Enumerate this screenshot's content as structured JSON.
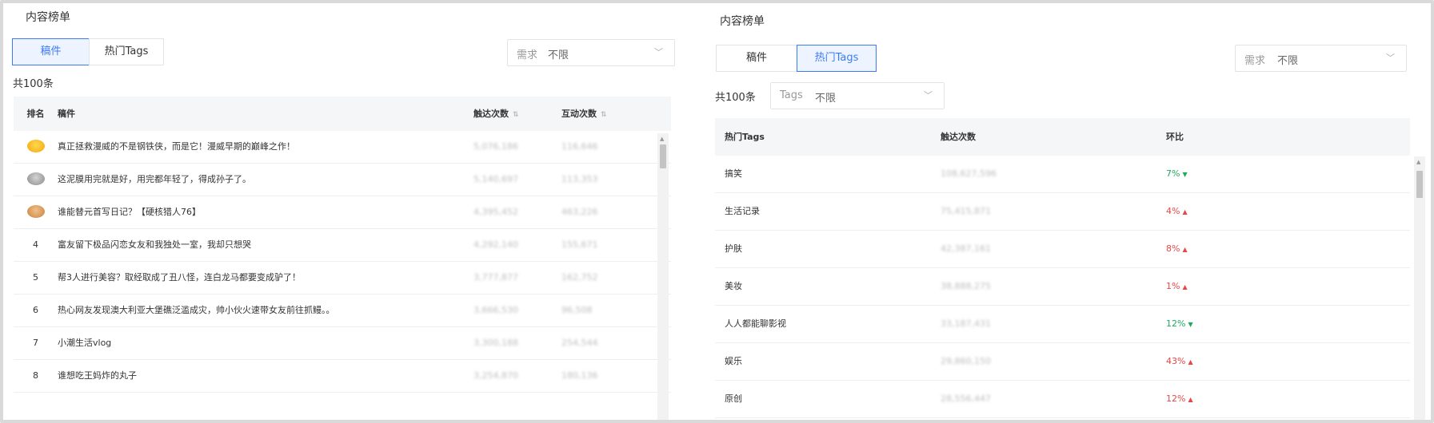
{
  "left": {
    "title": "内容榜单",
    "tabs": [
      {
        "label": "稿件",
        "active": true
      },
      {
        "label": "热门Tags",
        "active": false
      }
    ],
    "need_filter": {
      "label": "需求",
      "value": "不限"
    },
    "count": "共100条",
    "columns": {
      "rank": "排名",
      "title": "稿件",
      "reach": "触达次数",
      "interact": "互动次数"
    },
    "rows": [
      {
        "rank": "",
        "medal": "gold",
        "title": "真正拯救漫威的不是钢铁侠，而是它！漫威早期的巅峰之作！",
        "reach": "5,076,186",
        "interact": "116,646"
      },
      {
        "rank": "",
        "medal": "silver",
        "title": "这泥膜用完就是好，用完都年轻了，得成孙子了。",
        "reach": "5,140,697",
        "interact": "113,353"
      },
      {
        "rank": "",
        "medal": "bronze",
        "title": "谁能替元首写日记？【硬核猎人76】",
        "reach": "4,395,452",
        "interact": "463,226"
      },
      {
        "rank": "4",
        "medal": "",
        "title": "富友留下极品闪恋女友和我独处一室，我却只想哭",
        "reach": "4,292,140",
        "interact": "155,671"
      },
      {
        "rank": "5",
        "medal": "",
        "title": "帮3人进行美容？取经取成了丑八怪，连白龙马都要变成驴了！",
        "reach": "3,777,877",
        "interact": "162,752"
      },
      {
        "rank": "6",
        "medal": "",
        "title": "热心网友发现澳大利亚大堡礁泛滥成灾，帅小伙火速带女友前往抓鳗。。",
        "reach": "3,666,530",
        "interact": "96,508"
      },
      {
        "rank": "7",
        "medal": "",
        "title": "小潮生活vlog",
        "reach": "3,300,188",
        "interact": "254,544"
      },
      {
        "rank": "8",
        "medal": "",
        "title": "谁想吃王妈炸的丸子",
        "reach": "3,254,870",
        "interact": "180,136"
      }
    ]
  },
  "right": {
    "title": "内容榜单",
    "tabs": [
      {
        "label": "稿件",
        "active": false
      },
      {
        "label": "热门Tags",
        "active": true
      }
    ],
    "need_filter": {
      "label": "需求",
      "value": "不限"
    },
    "count": "共100条",
    "tags_filter": {
      "label": "Tags",
      "value": "不限"
    },
    "columns": {
      "tag": "热门Tags",
      "reach": "触达次数",
      "ratio": "环比"
    },
    "rows": [
      {
        "tag": "搞笑",
        "reach": "108,627,596",
        "ratio": "7%",
        "trend": "down"
      },
      {
        "tag": "生活记录",
        "reach": "75,415,871",
        "ratio": "4%",
        "trend": "up"
      },
      {
        "tag": "护肤",
        "reach": "42,387,161",
        "ratio": "8%",
        "trend": "up"
      },
      {
        "tag": "美妆",
        "reach": "38,888,275",
        "ratio": "1%",
        "trend": "up"
      },
      {
        "tag": "人人都能聊影视",
        "reach": "33,187,431",
        "ratio": "12%",
        "trend": "down"
      },
      {
        "tag": "娱乐",
        "reach": "29,860,150",
        "ratio": "43%",
        "trend": "up"
      },
      {
        "tag": "原创",
        "reach": "28,556,447",
        "ratio": "12%",
        "trend": "up"
      }
    ]
  },
  "colors": {
    "accent": "#3d7bf5",
    "up": "#e94747",
    "down": "#1daa5c",
    "header_bg": "#f5f6f8"
  },
  "icons": {
    "sort": "sort-icon",
    "chevron": "chevron-down-icon",
    "medals": [
      "gold-medal-icon",
      "silver-medal-icon",
      "bronze-medal-icon"
    ]
  }
}
